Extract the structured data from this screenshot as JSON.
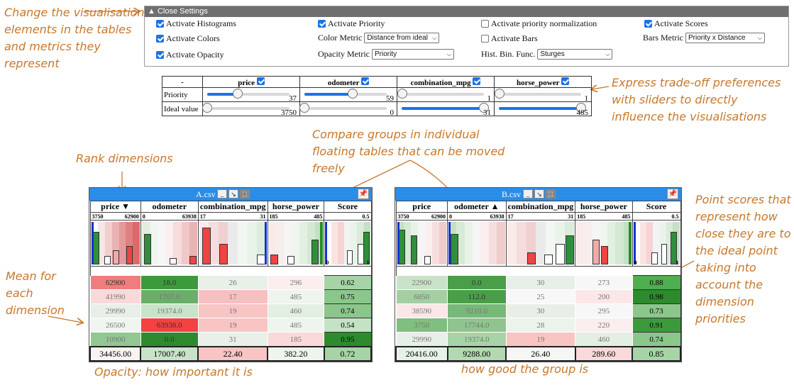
{
  "annotations": {
    "change_vis": "Change the visualisation elements in the tables and metrics they represent",
    "trade_off": "Express trade-off preferences with sliders to directly influence the visualisations",
    "compare_groups": "Compare groups in individual floating tables that can be moved freely",
    "rank": "Rank dimensions",
    "point_scores": "Point scores that represent how close they are to the ideal point taking into account the dimension priorities",
    "mean_dim": "Mean for each dimension",
    "color_opacity": "Color : how good a value is Opacity: how important it is",
    "mean_scores": "Mean of scores to represent how good the group is"
  },
  "settings": {
    "header": "▲ Close Settings",
    "activate_histograms": "Activate Histograms",
    "activate_priority": "Activate Priority",
    "activate_priority_norm": "Activate priority normalization",
    "activate_scores": "Activate Scores",
    "activate_colors": "Activate Colors",
    "color_metric_label": "Color Metric",
    "color_metric_value": "Distance from ideal",
    "activate_bars": "Activate Bars",
    "bars_metric_label": "Bars Metric",
    "bars_metric_value": "Priority x Distance",
    "activate_opacity": "Activate Opacity",
    "opacity_metric_label": "Opacity Metric",
    "opacity_metric_value": "Priority",
    "hist_bin_label": "Hist. Bin. Func.",
    "hist_bin_value": "Sturges"
  },
  "priority_table": {
    "corner": "-",
    "dims": [
      "price",
      "odometer",
      "combination_mpg",
      "horse_power"
    ],
    "priority_label": "Priority",
    "ideal_label": "Ideal value",
    "priority_values": [
      "37",
      "59",
      "1",
      "1"
    ],
    "priority_fraction": [
      0.37,
      0.59,
      0.01,
      0.01
    ],
    "ideal_values": [
      "3750",
      "0",
      "31",
      "485"
    ],
    "ideal_fraction": [
      0.0,
      0.0,
      1.0,
      1.0
    ]
  },
  "table_a": {
    "title": "A.csv",
    "headers": [
      "price ▼",
      "odometer",
      "combination_mpg",
      "horse_power",
      "Score"
    ],
    "ranges": [
      [
        "3750",
        "62900"
      ],
      [
        "0",
        "63938"
      ],
      [
        "17",
        "31"
      ],
      [
        "185",
        "485"
      ],
      [
        "",
        "0.5"
      ]
    ],
    "score_axis": [
      "0",
      "1"
    ],
    "rows": [
      [
        "62900",
        "18.0",
        "26",
        "296",
        "0.62"
      ],
      [
        "41990",
        "1707.0",
        "17",
        "485",
        "0.75"
      ],
      [
        "29990",
        "19374.0",
        "19",
        "460",
        "0.74"
      ],
      [
        "26500",
        "63938.0",
        "19",
        "485",
        "0.54"
      ],
      [
        "10900",
        "0.0",
        "31",
        "185",
        "0.95"
      ]
    ],
    "means": [
      "34456.00",
      "17007.40",
      "22.40",
      "382.20",
      "0.72"
    ]
  },
  "table_b": {
    "title": "B.csv",
    "headers": [
      "price",
      "odometer ▲",
      "combination_mpg",
      "horse_power",
      "Score"
    ],
    "ranges": [
      [
        "3750",
        "62900"
      ],
      [
        "0",
        "63938"
      ],
      [
        "17",
        "31"
      ],
      [
        "185",
        "485"
      ],
      [
        "",
        "0.5"
      ]
    ],
    "score_axis": [
      "0",
      "1"
    ],
    "rows": [
      [
        "22900",
        "0.0",
        "30",
        "273",
        "0.88"
      ],
      [
        "6850",
        "112.0",
        "25",
        "200",
        "0.98"
      ],
      [
        "38590",
        "9210.0",
        "30",
        "295",
        "0.73"
      ],
      [
        "3750",
        "17744.0",
        "28",
        "220",
        "0.91"
      ],
      [
        "29990",
        "19374.0",
        "19",
        "460",
        "0.74"
      ]
    ],
    "means": [
      "20416.00",
      "9288.00",
      "26.40",
      "289.60",
      "0.85"
    ]
  },
  "colors": {
    "good": "#1f8a1f",
    "bad": "#e03030",
    "title_bar": "#2b8de8",
    "annotation": "#c8782a"
  }
}
